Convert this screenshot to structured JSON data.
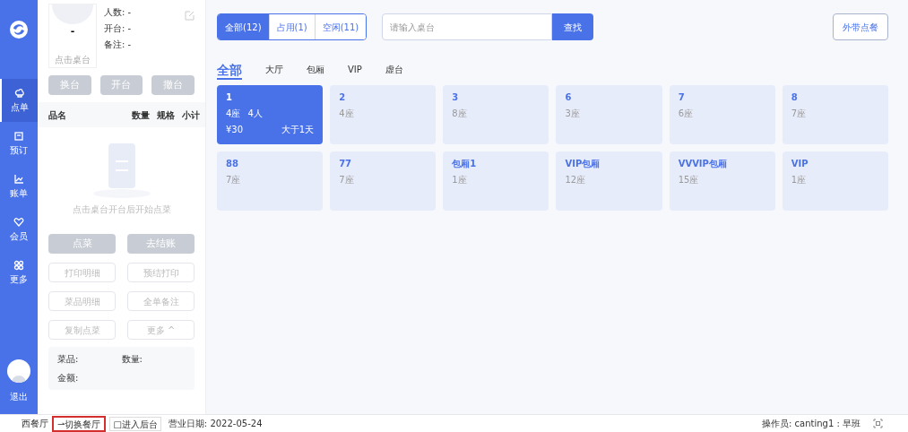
{
  "nav": {
    "items": [
      {
        "label": "点单",
        "selected": true
      },
      {
        "label": "预订",
        "selected": false
      },
      {
        "label": "账单",
        "selected": false
      },
      {
        "label": "会员",
        "selected": false
      },
      {
        "label": "更多",
        "selected": false
      }
    ],
    "logout": "退出"
  },
  "table_info": {
    "name": "-",
    "hint": "点击桌台",
    "fields": [
      "人数: -",
      "开台: -",
      "备注: -"
    ],
    "actions": [
      {
        "label": "换台",
        "disabled": true
      },
      {
        "label": "开台",
        "disabled": true
      },
      {
        "label": "撤台",
        "disabled": true
      }
    ]
  },
  "order": {
    "columns": [
      "品名",
      "数量",
      "规格",
      "小计"
    ],
    "empty_text": "点击桌台开台后开始点菜",
    "primary_buttons": [
      {
        "label": "点菜",
        "disabled": true
      },
      {
        "label": "去结账",
        "disabled": true
      }
    ],
    "buttons": [
      {
        "label": "打印明细",
        "disabled": true
      },
      {
        "label": "预结打印",
        "disabled": true
      },
      {
        "label": "菜品明细",
        "disabled": true
      },
      {
        "label": "全单备注",
        "disabled": true
      },
      {
        "label": "复制点菜",
        "disabled": true
      },
      {
        "label": "更多 ^",
        "disabled": true
      }
    ],
    "summary": [
      "菜品:",
      "数量:",
      "金额:"
    ]
  },
  "filters": [
    {
      "label": "全部(12)",
      "selected": true
    },
    {
      "label": "占用(1)",
      "selected": false
    },
    {
      "label": "空闲(11)",
      "selected": false
    }
  ],
  "search": {
    "placeholder": "请输入桌台",
    "button": "查找"
  },
  "takeout_button": "外带点餐",
  "areas": [
    {
      "label": "全部",
      "selected": true
    },
    {
      "label": "大厅",
      "selected": false
    },
    {
      "label": "包厢",
      "selected": false
    },
    {
      "label": "VIP",
      "selected": false
    },
    {
      "label": "虚台",
      "selected": false
    }
  ],
  "tables": [
    {
      "name": "1",
      "seats": "4座",
      "occupied": true,
      "guests": "4人",
      "amount": "¥30",
      "duration": "大于1天"
    },
    {
      "name": "2",
      "seats": "4座",
      "occupied": false
    },
    {
      "name": "3",
      "seats": "8座",
      "occupied": false
    },
    {
      "name": "6",
      "seats": "3座",
      "occupied": false
    },
    {
      "name": "7",
      "seats": "6座",
      "occupied": false
    },
    {
      "name": "8",
      "seats": "7座",
      "occupied": false
    },
    {
      "name": "88",
      "seats": "7座",
      "occupied": false
    },
    {
      "name": "77",
      "seats": "7座",
      "occupied": false
    },
    {
      "name": "包厢1",
      "seats": "1座",
      "occupied": false
    },
    {
      "name": "VIP包厢",
      "seats": "12座",
      "occupied": false
    },
    {
      "name": "VVVIP包厢",
      "seats": "15座",
      "occupied": false
    },
    {
      "name": "VIP",
      "seats": "1座",
      "occupied": false
    }
  ],
  "status_bar": {
    "restaurant": "西餐厅",
    "switch_button": {
      "label": "⇀切换餐厅",
      "highlighted": true
    },
    "backend_button": "□进入后台",
    "business_date": "营业日期: 2022-05-24",
    "operator": "操作员: canting1 : 早班"
  }
}
